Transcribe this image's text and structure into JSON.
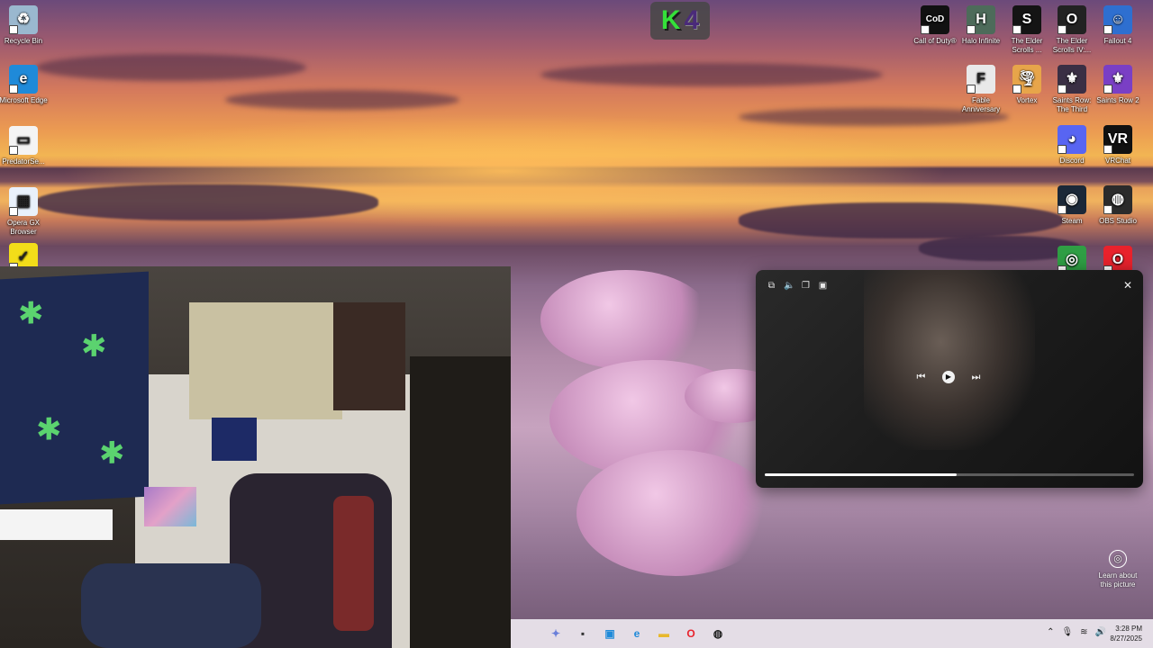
{
  "top_logo": {
    "letter": "K",
    "number": "4"
  },
  "desktop_left": [
    {
      "label": "Recycle Bin",
      "glyph": "♻",
      "color": "#9ab8cf",
      "icon": "recycle-bin-icon"
    },
    {
      "label": "Microsoft Edge",
      "glyph": "e",
      "color": "#1f8ad9",
      "icon": "edge-icon"
    },
    {
      "label": "PredatorSe...",
      "glyph": "▭",
      "color": "#f4f4f4",
      "icon": "file-icon"
    },
    {
      "label": "Opera GX Browser",
      "glyph": "▦",
      "color": "#e9f1fb",
      "icon": "opera-gx-icon"
    },
    {
      "label": "",
      "glyph": "✓",
      "color": "#f2dd19",
      "icon": "checkmark-app-icon"
    }
  ],
  "desktop_right": [
    {
      "label": "Call of Duty®",
      "glyph": "CoD",
      "color": "#111111",
      "icon": "call-of-duty-icon"
    },
    {
      "label": "Halo Infinite",
      "glyph": "H",
      "color": "#4d6b5a",
      "icon": "halo-infinite-icon"
    },
    {
      "label": "The Elder Scrolls ...",
      "glyph": "S",
      "color": "#141414",
      "icon": "elder-scrolls-icon"
    },
    {
      "label": "The Elder Scrolls IV:...",
      "glyph": "O",
      "color": "#222222",
      "icon": "oblivion-icon"
    },
    {
      "label": "Fallout 4",
      "glyph": "☺",
      "color": "#2e6fd0",
      "icon": "fallout-4-icon"
    },
    {
      "label": "Fable Anniversary",
      "glyph": "F",
      "color": "#e9e9e9",
      "icon": "fable-icon"
    },
    {
      "label": "Vortex",
      "glyph": "🌪",
      "color": "#e7a54a",
      "icon": "vortex-icon"
    },
    {
      "label": "Saints Row: The Third",
      "glyph": "⚜",
      "color": "#3a2f44",
      "icon": "saints-row-third-icon"
    },
    {
      "label": "Saints Row 2",
      "glyph": "⚜",
      "color": "#7a3fc5",
      "icon": "saints-row-2-icon"
    },
    {
      "label": "Discord",
      "glyph": "◕",
      "color": "#5865f2",
      "icon": "discord-icon"
    },
    {
      "label": "VRChat",
      "glyph": "VR",
      "color": "#111111",
      "icon": "vrchat-icon"
    },
    {
      "label": "Steam",
      "glyph": "◉",
      "color": "#1b2838",
      "icon": "steam-icon"
    },
    {
      "label": "OBS Studio",
      "glyph": "◍",
      "color": "#2b2b2b",
      "icon": "obs-studio-icon"
    },
    {
      "label": "",
      "glyph": "◎",
      "color": "#2f9e44",
      "icon": "chrome-icon"
    },
    {
      "label": "",
      "glyph": "O",
      "color": "#e8222c",
      "icon": "opera-icon"
    }
  ],
  "player": {
    "tools": [
      "pip-icon",
      "volume-icon",
      "copy-icon",
      "cast-icon"
    ],
    "progress": 0.52
  },
  "learn": {
    "label": "Learn about this picture"
  },
  "taskbar": {
    "apps": [
      {
        "name": "widgets-icon",
        "glyph": "✦",
        "color": "#6a7fd9"
      },
      {
        "name": "task-view-icon",
        "glyph": "▪",
        "color": "#333333"
      },
      {
        "name": "store-icon",
        "glyph": "▣",
        "color": "#1f8ad9"
      },
      {
        "name": "edge-taskbar-icon",
        "glyph": "e",
        "color": "#1f8ad9"
      },
      {
        "name": "file-explorer-icon",
        "glyph": "▬",
        "color": "#e8b82c"
      },
      {
        "name": "opera-taskbar-icon",
        "glyph": "O",
        "color": "#e8222c"
      },
      {
        "name": "obs-taskbar-icon",
        "glyph": "◍",
        "color": "#222222"
      }
    ],
    "time": "3:28 PM",
    "date": "8/27/2025"
  }
}
